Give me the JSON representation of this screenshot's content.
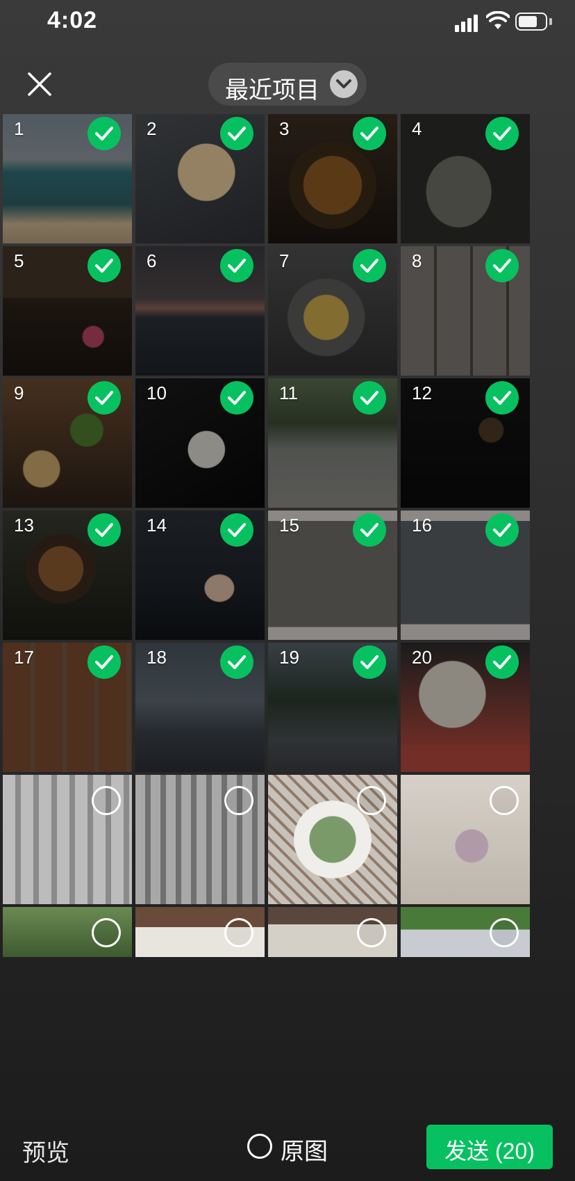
{
  "status_bar": {
    "time": "4:02"
  },
  "header": {
    "album_title": "最近项目"
  },
  "grid": {
    "selected_count": 20,
    "photos": [
      {
        "selection_number": "1",
        "selected": true
      },
      {
        "selection_number": "2",
        "selected": true
      },
      {
        "selection_number": "3",
        "selected": true
      },
      {
        "selection_number": "4",
        "selected": true
      },
      {
        "selection_number": "5",
        "selected": true
      },
      {
        "selection_number": "6",
        "selected": true
      },
      {
        "selection_number": "7",
        "selected": true
      },
      {
        "selection_number": "8",
        "selected": true
      },
      {
        "selection_number": "9",
        "selected": true
      },
      {
        "selection_number": "10",
        "selected": true
      },
      {
        "selection_number": "11",
        "selected": true
      },
      {
        "selection_number": "12",
        "selected": true
      },
      {
        "selection_number": "13",
        "selected": true
      },
      {
        "selection_number": "14",
        "selected": true
      },
      {
        "selection_number": "15",
        "selected": true
      },
      {
        "selection_number": "16",
        "selected": true
      },
      {
        "selection_number": "17",
        "selected": true
      },
      {
        "selection_number": "18",
        "selected": true
      },
      {
        "selection_number": "19",
        "selected": true
      },
      {
        "selection_number": "20",
        "selected": true
      },
      {
        "selection_number": "",
        "selected": false
      },
      {
        "selection_number": "",
        "selected": false
      },
      {
        "selection_number": "",
        "selected": false
      },
      {
        "selection_number": "",
        "selected": false
      },
      {
        "selection_number": "",
        "selected": false
      },
      {
        "selection_number": "",
        "selected": false
      },
      {
        "selection_number": "",
        "selected": false
      },
      {
        "selection_number": "",
        "selected": false
      }
    ]
  },
  "bottom_bar": {
    "preview_label": "预览",
    "original_label": "原图",
    "send_label": "发送 (20)"
  },
  "colors": {
    "accent": "#07c160",
    "pill": "#4a4a4a"
  }
}
